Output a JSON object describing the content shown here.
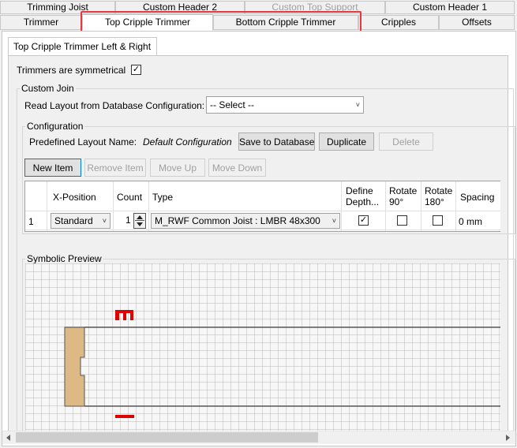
{
  "tabs_row1": [
    "Trimming Joist",
    "Custom Header 2",
    "Custom Top Support",
    "Custom Header 1"
  ],
  "tabs_row2": [
    "Trimmer",
    "Top Cripple Trimmer",
    "Bottom Cripple Trimmer",
    "Cripples",
    "Offsets"
  ],
  "subtab": "Top Cripple Trimmer Left & Right",
  "symmetric": {
    "label": "Trimmers are symmetrical",
    "checked": "✓"
  },
  "custom_join": {
    "title": "Custom Join",
    "read_label": "Read Layout from Database Configuration:",
    "select_value": "-- Select --"
  },
  "configuration": {
    "title": "Configuration",
    "predefined_label": "Predefined Layout Name:",
    "predefined_value": "Default Configuration",
    "save_label": "Save to Database",
    "duplicate_label": "Duplicate",
    "delete_label": "Delete"
  },
  "item_buttons": {
    "new": "New Item",
    "remove": "Remove Item",
    "up": "Move Up",
    "down": "Move Down"
  },
  "table": {
    "headers": {
      "xpos": "X-Position",
      "count": "Count",
      "type": "Type",
      "depth": "Define Depth...",
      "rot90": "Rotate 90°",
      "rot180": "Rotate 180°",
      "spacing": "Spacing"
    },
    "row": {
      "num": "1",
      "xpos": "Standard",
      "count": "1",
      "type": "M_RWF Common Joist : LMBR 48x300",
      "depth_check": "✓",
      "spacing": "0 mm"
    }
  },
  "preview": {
    "title": "Symbolic Preview"
  },
  "colors": {
    "highlight": "#e8383d",
    "member": "#ddb985",
    "marker": "#e00000"
  }
}
